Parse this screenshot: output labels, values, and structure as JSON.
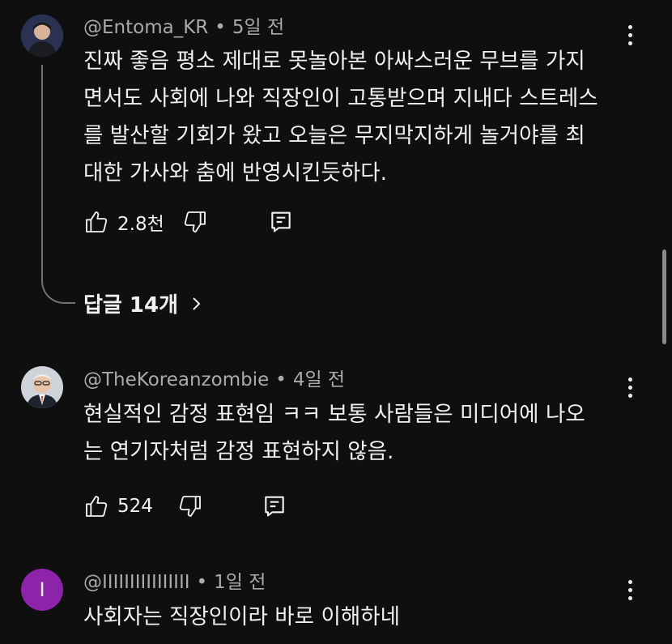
{
  "comments": [
    {
      "handle": "@Entoma_KR",
      "time": "5일 전",
      "lines": [
        "진짜 좋음  평소 제대로 못놀아본 아싸스러운 무브를 가지",
        "면서도 사회에 나와 직장인이 고통받으며 지내다 스트레스",
        "를 발산할 기회가 왔고 오늘은 무지막지하게 놀거야를 최",
        "대한 가사와 춤에 반영시킨듯하다."
      ],
      "likes": "2.8천",
      "replies_label": "답글 14개"
    },
    {
      "handle": "@TheKoreanzombie",
      "time": "4일 전",
      "lines": [
        "현실적인 감정 표현임 ㅋㅋ 보통 사람들은 미디어에 나오",
        "는 연기자처럼 감정 표현하지 않음."
      ],
      "likes": "524"
    },
    {
      "handle": "@IIIIIIIIIIIIIIII",
      "time": "1일 전",
      "avatar_letter": "I",
      "avatar_color": "#8e24aa",
      "lines": [
        "사회자는 직장인이라 바로 이해하네"
      ]
    }
  ],
  "icons": {
    "like": "thumbs-up-icon",
    "dislike": "thumbs-down-icon",
    "reply": "reply-icon",
    "more": "more-vert-icon",
    "chevron": "chevron-right-icon"
  }
}
